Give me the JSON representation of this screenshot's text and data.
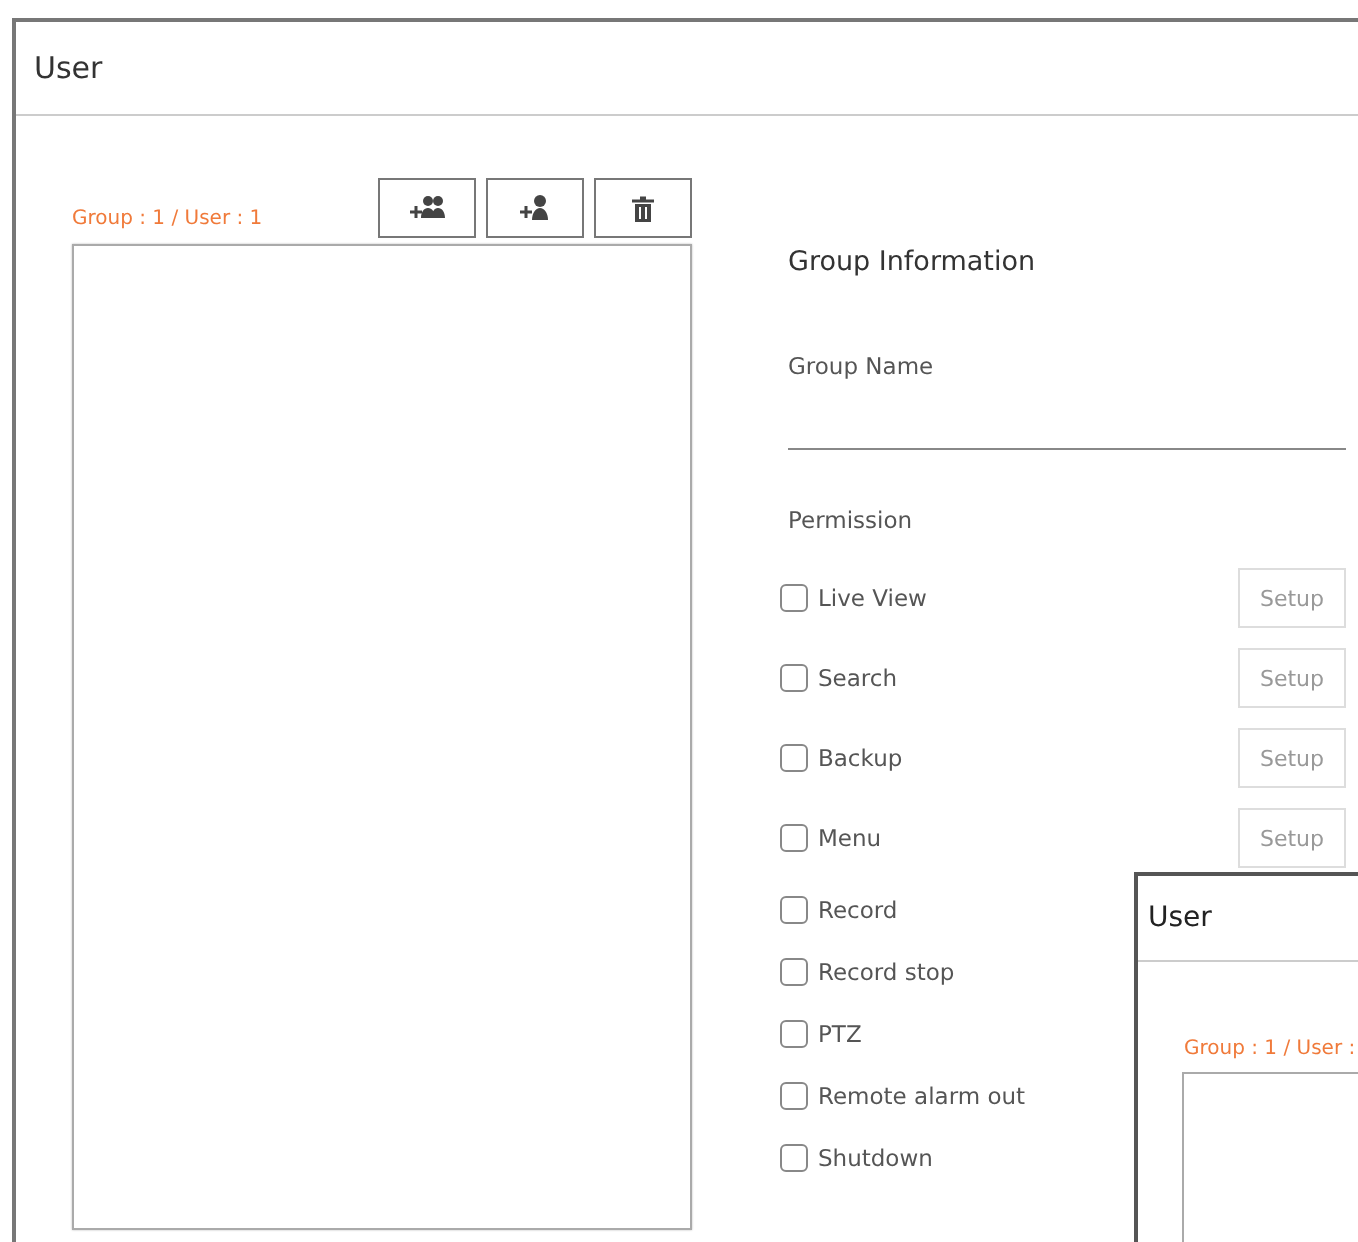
{
  "window": {
    "title": "User"
  },
  "counts": "Group : 1 / User : 1",
  "toolbar": [
    {
      "kind": "add-group"
    },
    {
      "kind": "add-user"
    },
    {
      "kind": "delete"
    }
  ],
  "group_info": {
    "heading": "Group Information",
    "name_label": "Group Name",
    "permission_label": "Permission"
  },
  "permissions": [
    {
      "label": "Live View",
      "checked": false,
      "setup": "Setup"
    },
    {
      "label": "Search",
      "checked": false,
      "setup": "Setup"
    },
    {
      "label": "Backup",
      "checked": false,
      "setup": "Setup"
    },
    {
      "label": "Menu",
      "checked": false,
      "setup": "Setup"
    },
    {
      "label": "Record",
      "checked": false
    },
    {
      "label": "Record stop",
      "checked": false
    },
    {
      "label": "PTZ",
      "checked": false
    },
    {
      "label": "Remote alarm out",
      "checked": false
    },
    {
      "label": "Shutdown",
      "checked": false
    }
  ],
  "overlay_window": {
    "title": "User",
    "counts": "Group : 1 / User :"
  }
}
